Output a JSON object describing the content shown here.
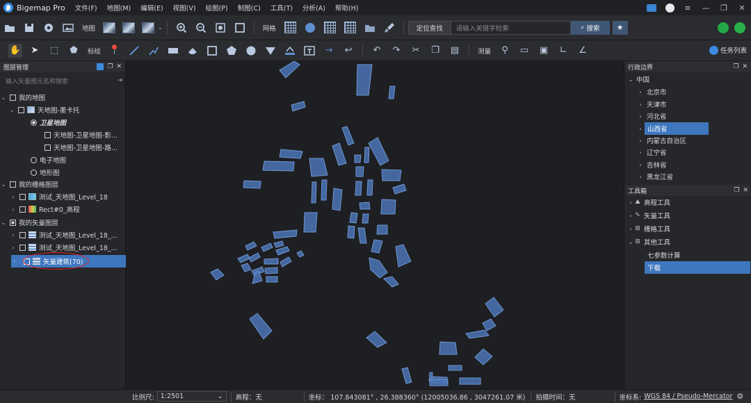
{
  "app": {
    "title": "Bigemap Pro",
    "menu": [
      "文件(F)",
      "地图(M)",
      "编辑(E)",
      "视图(V)",
      "绘图(P)",
      "制图(C)",
      "工具(T)",
      "分析(A)",
      "帮助(H)"
    ]
  },
  "toolbar": {
    "map_label": "地图",
    "grid_label": "网格",
    "locate_label": "定位查找",
    "search_placeholder": "请输入关键字检索",
    "search_button": "搜索",
    "draw_label": "标绘",
    "measure_label": "测量",
    "task_list": "任务列表"
  },
  "layer_panel": {
    "title": "图层管理",
    "search_placeholder": "输入矢量图元名称搜索",
    "items": [
      {
        "label": "我的地图"
      },
      {
        "label": "天地图-墨卡托"
      },
      {
        "label": "卫星地图"
      },
      {
        "label": "天地图-卫星地图-影..."
      },
      {
        "label": "天地图-卫星地图-路..."
      },
      {
        "label": "电子地图"
      },
      {
        "label": "地形图"
      },
      {
        "label": "我的栅格图层"
      },
      {
        "label": "测试_天地图_Level_18"
      },
      {
        "label": "Rect#0_高程"
      },
      {
        "label": "我的矢量图层"
      },
      {
        "label": "测试_天地图_Level_18_..."
      },
      {
        "label": "测试_天地图_Level_18_..."
      },
      {
        "label": "矢量建筑(70)"
      }
    ]
  },
  "admin_panel": {
    "title": "行政边界",
    "root": "中国",
    "items": [
      "北京市",
      "天津市",
      "河北省",
      "山西省",
      "内蒙古自治区",
      "辽宁省",
      "吉林省",
      "黑龙江省"
    ],
    "selected": "山西省"
  },
  "toolbox_panel": {
    "title": "工具箱",
    "items": [
      "高程工具",
      "矢量工具",
      "栅格工具",
      "其他工具"
    ],
    "sub_items": [
      "七参数计算",
      "下载"
    ],
    "selected": "下载"
  },
  "status": {
    "scale_label": "比例尺:",
    "scale_value": "1:2501",
    "elevation": "高程：无",
    "coords": "坐标： 107.843081° , 26.388360°   (12005036.86 , 3047261.07 米)",
    "capture_time": "拍摄时间：无",
    "crs_label": "坐标系:",
    "crs_value": "WGS 84 / Pseudo-Mercator"
  },
  "colors": {
    "building_fill": "#4a74b4",
    "building_stroke": "#6f97d4",
    "selection": "#3f77bf",
    "highlight_ellipse": "#e02424"
  }
}
